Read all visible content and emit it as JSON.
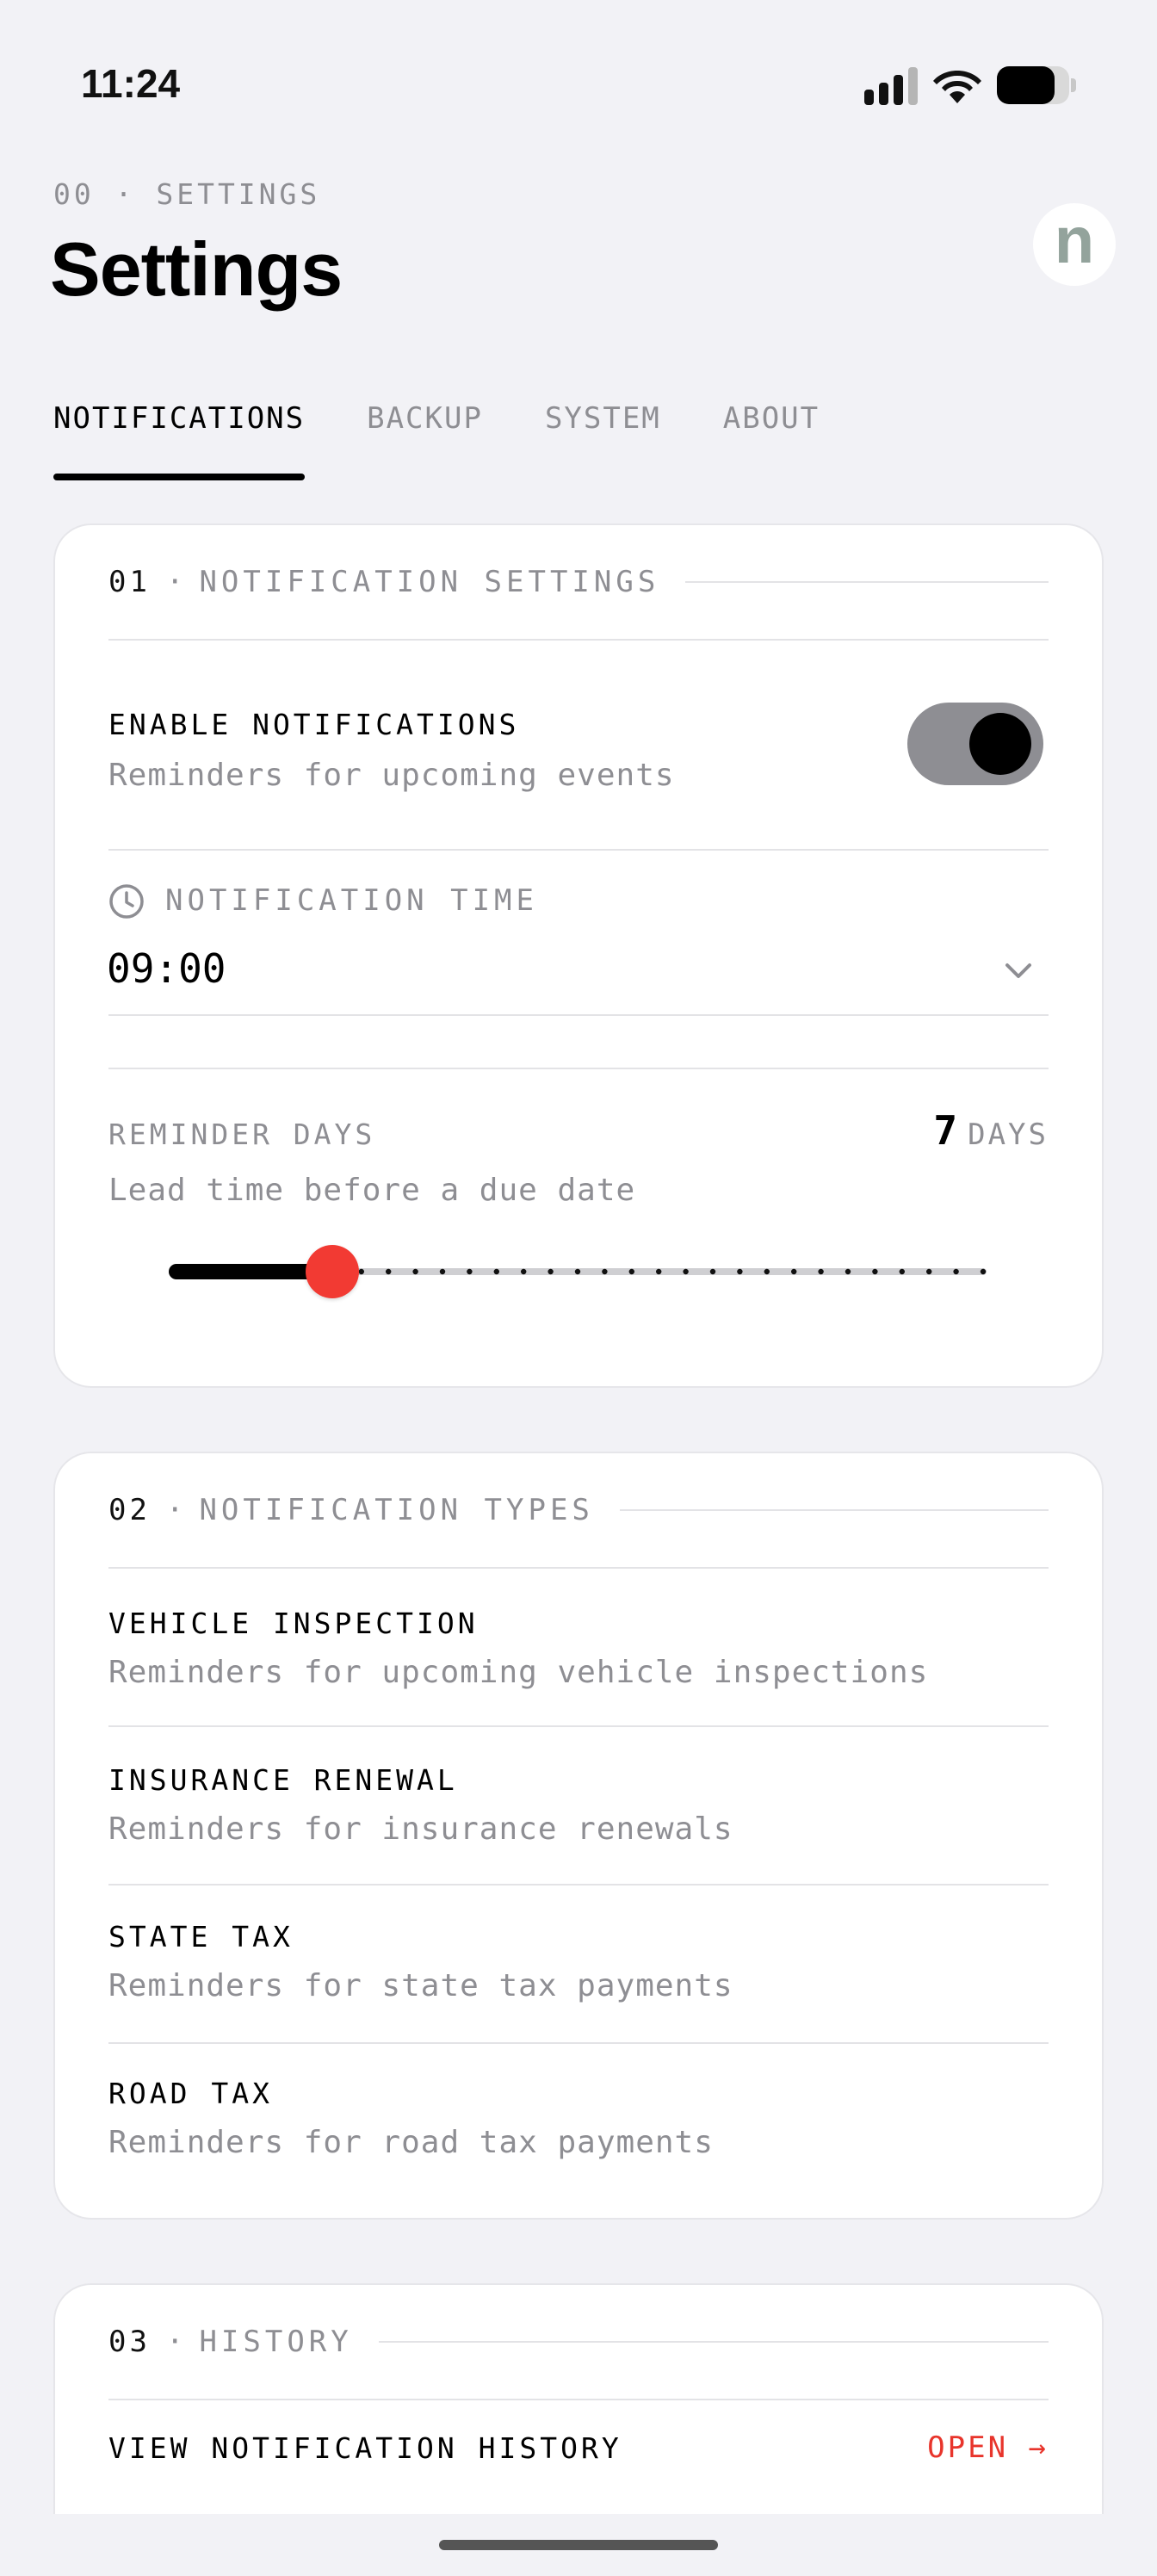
{
  "status_bar": {
    "time": "11:24",
    "signal_icon": "cellular-signal-icon",
    "wifi_icon": "wifi-icon",
    "battery_icon": "battery-icon",
    "battery_level": 0.8
  },
  "header": {
    "crumb": "00 · SETTINGS",
    "title": "Settings",
    "logo_letter": "n"
  },
  "tabs": [
    {
      "label": "NOTIFICATIONS",
      "active": true
    },
    {
      "label": "BACKUP",
      "active": false
    },
    {
      "label": "SYSTEM",
      "active": false
    },
    {
      "label": "ABOUT",
      "active": false
    }
  ],
  "notification_settings": {
    "num": "01",
    "sep": "·",
    "title": "NOTIFICATION SETTINGS",
    "enable": {
      "label": "ENABLE NOTIFICATIONS",
      "description": "Reminders for upcoming events",
      "on": true
    },
    "time": {
      "label": "NOTIFICATION TIME",
      "value": "09:00",
      "icon": "clock-icon",
      "dropdown_icon": "chevron-down-icon"
    },
    "reminder_days": {
      "label": "REMINDER DAYS",
      "description": "Lead time before a due date",
      "value": "7",
      "unit": "DAYS",
      "slider_fraction": 0.2
    }
  },
  "notification_types": {
    "num": "02",
    "sep": "·",
    "title": "NOTIFICATION TYPES",
    "items": [
      {
        "label": "VEHICLE INSPECTION",
        "description": "Reminders for upcoming vehicle inspections"
      },
      {
        "label": "INSURANCE RENEWAL",
        "description": "Reminders for insurance renewals"
      },
      {
        "label": "STATE TAX",
        "description": "Reminders for state tax payments"
      },
      {
        "label": "ROAD TAX",
        "description": "Reminders for road tax payments"
      }
    ]
  },
  "history": {
    "num": "03",
    "sep": "·",
    "title": "HISTORY",
    "view_label": "VIEW NOTIFICATION HISTORY",
    "open_label": "OPEN →"
  },
  "colors": {
    "accent": "#f23a33",
    "muted": "#8e8e93",
    "background": "#f2f2f6"
  }
}
